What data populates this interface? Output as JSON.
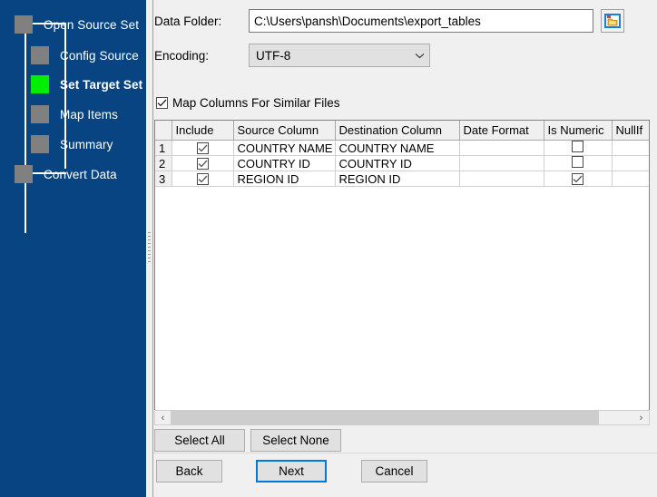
{
  "sidebar": {
    "steps": [
      {
        "label": "Open Source Set",
        "active": false
      },
      {
        "label": "Config Source",
        "active": false
      },
      {
        "label": "Set Target Set",
        "active": true
      },
      {
        "label": "Map Items",
        "active": false
      },
      {
        "label": "Summary",
        "active": false
      },
      {
        "label": "Convert Data",
        "active": false
      }
    ],
    "background_color": "#084482",
    "node_color": "#808080",
    "active_node_color": "#00ee00"
  },
  "form": {
    "data_folder_label": "Data Folder:",
    "data_folder_value": "C:\\Users\\pansh\\Documents\\export_tables",
    "data_folder_placeholder": "",
    "browse_icon": "folder-icon",
    "encoding_label": "Encoding:",
    "encoding_value": "UTF-8",
    "encoding_options": [
      "UTF-8"
    ],
    "map_columns_label": "Map Columns For Similar Files",
    "map_columns_checked": true
  },
  "grid": {
    "columns": [
      "",
      "Include",
      "Source Column",
      "Destination Column",
      "Date Format",
      "Is Numeric",
      "NullIf"
    ],
    "rows": [
      {
        "num": "1",
        "include": true,
        "source_column": "COUNTRY NAME",
        "destination_column": "COUNTRY NAME",
        "date_format": "",
        "is_numeric": false,
        "nullif": ""
      },
      {
        "num": "2",
        "include": true,
        "source_column": "COUNTRY ID",
        "destination_column": "COUNTRY ID",
        "date_format": "",
        "is_numeric": false,
        "nullif": ""
      },
      {
        "num": "3",
        "include": true,
        "source_column": "REGION ID",
        "destination_column": "REGION ID",
        "date_format": "",
        "is_numeric": true,
        "nullif": ""
      }
    ]
  },
  "scrollbar": {
    "left_arrow": "‹",
    "right_arrow": "›"
  },
  "actions": {
    "select_all": "Select All",
    "select_none": "Select None",
    "back": "Back",
    "next": "Next",
    "cancel": "Cancel",
    "focus_color": "#0078d7"
  }
}
